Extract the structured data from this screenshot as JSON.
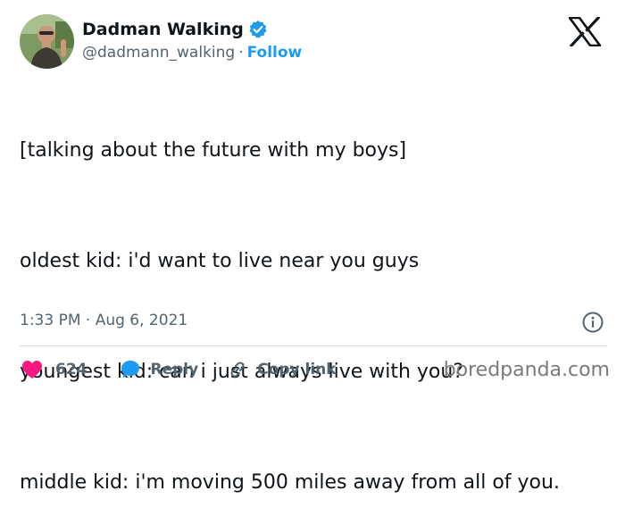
{
  "author": {
    "display_name": "Dadman Walking",
    "handle": "@dadmann_walking",
    "separator": "·",
    "follow_label": "Follow"
  },
  "tweet": {
    "lines": [
      "[talking about the future with my boys]",
      "oldest kid: i'd want to live near you guys",
      "youngest kid: can i just always live with you?",
      "middle kid: i'm moving 500 miles away from all of you."
    ],
    "timestamp": "1:33 PM · Aug 6, 2021"
  },
  "actions": {
    "like_count": "624",
    "reply_label": "Reply",
    "copy_label": "Copy link"
  },
  "watermark": "boredpanda.com",
  "colors": {
    "accent": "#1d9bf0",
    "like": "#f91880",
    "secondary_text": "#536471",
    "divider": "#cfd9de"
  },
  "icons": [
    "verified-badge-icon",
    "x-logo-icon",
    "info-icon",
    "heart-icon",
    "reply-bubble-icon",
    "link-icon"
  ]
}
